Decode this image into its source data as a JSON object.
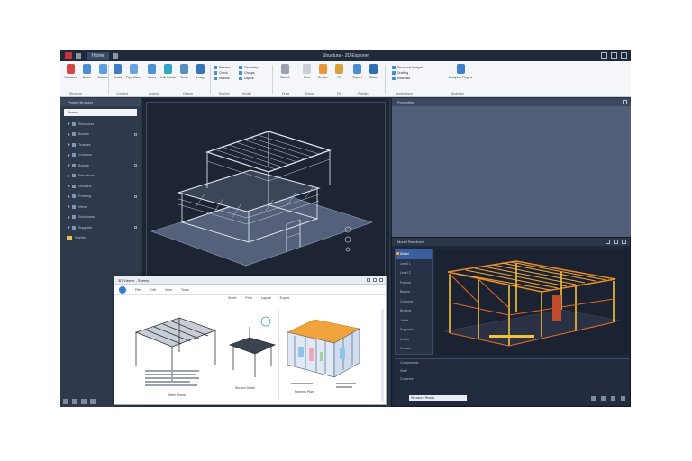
{
  "window": {
    "title": "Structura - 2D Explorer",
    "active_tab": "Home"
  },
  "ribbon": {
    "groups": [
      {
        "label": "Structure",
        "buttons": [
          "Structure",
          "Beam",
          "Column"
        ]
      },
      {
        "label": "Connect",
        "buttons": [
          "Model",
          "Pipe Conn."
        ]
      },
      {
        "label": "Analyze",
        "buttons": [
          "Views",
          "Edit Loads"
        ]
      },
      {
        "label": "Design",
        "buttons": [
          "Tools",
          "Design"
        ]
      },
      {
        "label": "Review",
        "list": [
          "Preview",
          "Check",
          "Results"
        ]
      },
      {
        "label": "Model",
        "list": [
          "Geometry",
          "Groups",
          "Layout"
        ]
      },
      {
        "label": "Draw",
        "buttons": [
          "Sketch"
        ]
      },
      {
        "label": "Export",
        "buttons": [
          "Print",
          "Render"
        ]
      },
      {
        "label": "Fit",
        "buttons": [
          "Fit"
        ]
      },
      {
        "label": "Publish",
        "buttons": [
          "Export",
          "Share"
        ]
      },
      {
        "label": "Applications",
        "list": [
          "Structural Analysis",
          "Drafting",
          "Materials"
        ]
      },
      {
        "label": "Analytics",
        "buttons": [
          "Analytics Plugins"
        ]
      }
    ]
  },
  "left_panel": {
    "header": "Project Browser",
    "search": "Search",
    "items": [
      "Structures",
      "Beams",
      "Trusses",
      "Columns",
      "Braces",
      "Elevations",
      "Sections",
      "Framing",
      "Views",
      "Schedules",
      "Supports",
      "Sheets"
    ]
  },
  "right_top_panel": {
    "header": "Properties"
  },
  "render_panel": {
    "header": "Model Rendered",
    "tree_items": [
      "Model",
      "Level 1",
      "Level 2",
      "Frames",
      "Beams",
      "Columns",
      "Bracing",
      "Joints",
      "Supports",
      "Loads",
      "Results"
    ],
    "bottom_header": "Components",
    "bottom_rows": [
      "Steel",
      "Concrete"
    ],
    "status": "Structure Ready"
  },
  "doc_window": {
    "title": "3D Viewer - Sheets",
    "toolbar": [
      "File",
      "Edit",
      "View",
      "Tools"
    ],
    "sub_toolbar": [
      "Sheet",
      "Print",
      "Layout",
      "Export"
    ],
    "captions": [
      "Steel Frame",
      "Section Detail",
      "Framing Plan"
    ]
  },
  "colors": {
    "app_bg": "#2a3445",
    "viewport_bg": "#1d2535",
    "ribbon_bg": "#f4f6f9",
    "accent": "#e8a33a",
    "selection": "#3a5f9c"
  }
}
